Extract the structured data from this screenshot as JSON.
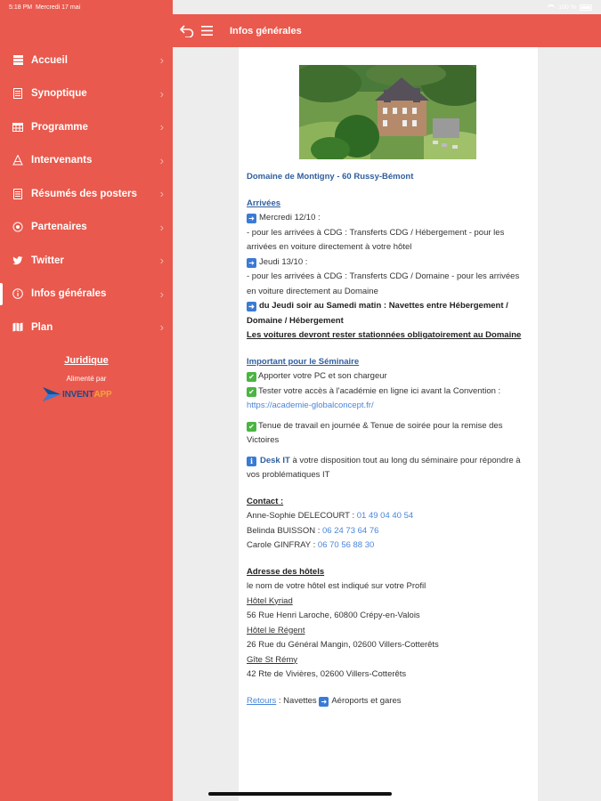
{
  "status_bar": {
    "time": "5:18 PM",
    "date": "Mercredi 17 mai",
    "battery": "100 %"
  },
  "header": {
    "title": "Infos générales"
  },
  "sidebar": {
    "items": [
      {
        "label": "Accueil",
        "icon": "home-icon"
      },
      {
        "label": "Synoptique",
        "icon": "document-icon"
      },
      {
        "label": "Programme",
        "icon": "calendar-icon"
      },
      {
        "label": "Intervenants",
        "icon": "speaker-icon"
      },
      {
        "label": "Résumés des posters",
        "icon": "document-icon"
      },
      {
        "label": "Partenaires",
        "icon": "handshake-icon"
      },
      {
        "label": "Twitter",
        "icon": "twitter-icon"
      },
      {
        "label": "Infos générales",
        "icon": "info-icon"
      },
      {
        "label": "Plan",
        "icon": "map-icon"
      }
    ],
    "juridique": "Juridique",
    "alimente": "Alimenté par",
    "logo_a": "INVENT",
    "logo_b": "APP"
  },
  "content": {
    "location_title": "Domaine de Montigny - 60 Russy-Bémont",
    "arrivees_title": "Arrivées",
    "arr1": "Mercredi 12/10 :",
    "arr1_text": "- pour les arrivées à CDG : Transferts CDG / Hébergement - pour les arrivées en voiture directement à votre hôtel",
    "arr2": "Jeudi 13/10 :",
    "arr2_text": "- pour les arrivées à CDG : Transferts CDG / Domaine - pour les arrivées en voiture directement au Domaine",
    "navettes": "du Jeudi soir au Samedi matin : Navettes entre Hébergement / Domaine / Hébergement",
    "voitures": "Les voitures devront rester stationnées obligatoirement au Domaine",
    "important_title": "Important pour le Séminaire",
    "imp1": "Apporter votre PC et son chargeur",
    "imp2": "Tester votre accès à l'académie en ligne ici avant la Convention :",
    "imp2_link": "https://academie-globalconcept.fr/",
    "imp3": "Tenue de travail en journée & Tenue de soirée pour la remise des Victoires",
    "desk_label": "Desk IT",
    "desk_text": "à votre disposition tout au long du séminaire pour répondre à vos problématiques IT",
    "contact_title": "Contact :",
    "contacts": [
      {
        "name": "Anne-Sophie DELECOURT :",
        "phone": "01 49 04 40 54"
      },
      {
        "name": "Belinda BUISSON :",
        "phone": "06 24 73 64 76"
      },
      {
        "name": "Carole GINFRAY :",
        "phone": "06 70 56 88 30"
      }
    ],
    "adresse_title": "Adresse des hôtels",
    "adresse_intro": "le nom de votre hôtel est indiqué sur votre Profil",
    "hotel1": "Hôtel Kyriad",
    "hotel1_addr": "56 Rue Henri Laroche, 60800 Crépy-en-Valois",
    "hotel2": "Hôtel le Régent",
    "hotel2_addr": "26 Rue du Général Mangin, 02600 Villers-Cotterêts",
    "hotel3": "Gîte St Rémy",
    "hotel3_addr": "42 Rte de Vivières, 02600 Villers-Cotterêts",
    "retours_label": "Retours",
    "retours_a": ": Navettes",
    "retours_b": "Aéroports et gares"
  }
}
